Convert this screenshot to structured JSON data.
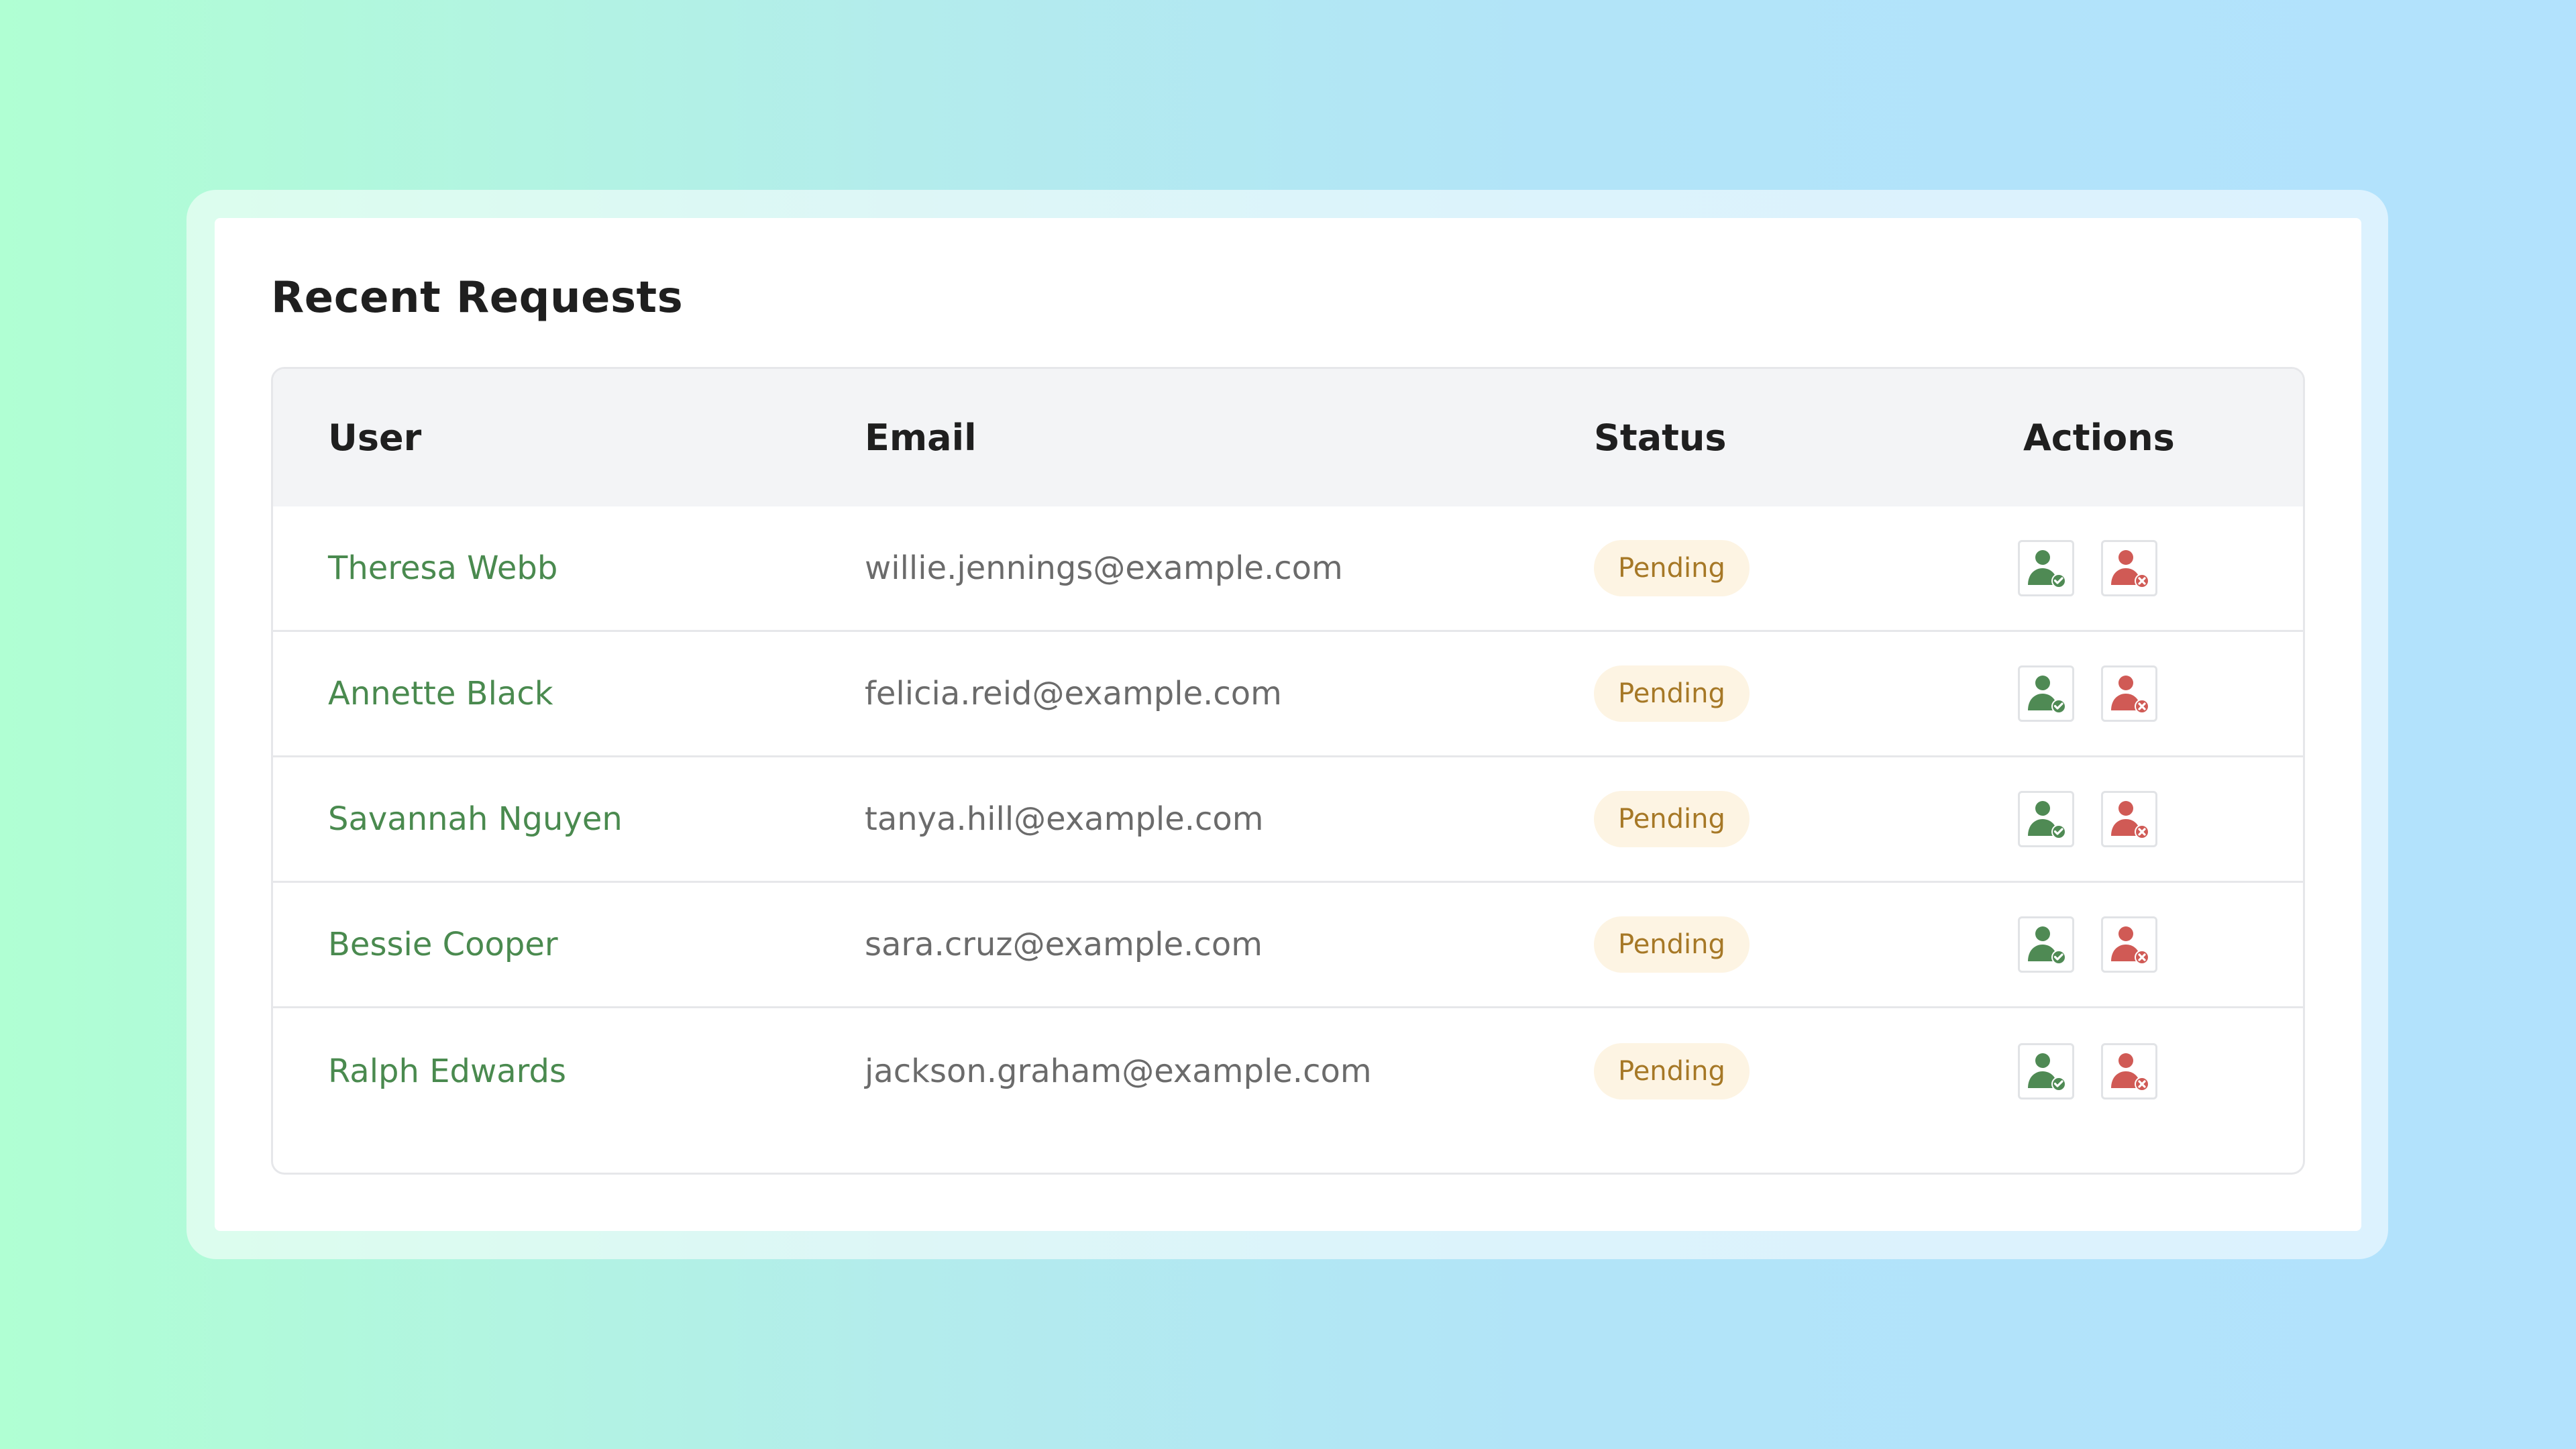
{
  "title": "Recent Requests",
  "columns": {
    "user": "User",
    "email": "Email",
    "status": "Status",
    "actions": "Actions"
  },
  "rows": [
    {
      "user": "Theresa Webb",
      "email": "willie.jennings@example.com",
      "status": "Pending"
    },
    {
      "user": "Annette Black",
      "email": "felicia.reid@example.com",
      "status": "Pending"
    },
    {
      "user": "Savannah Nguyen",
      "email": "tanya.hill@example.com",
      "status": "Pending"
    },
    {
      "user": "Bessie Cooper",
      "email": "sara.cruz@example.com",
      "status": "Pending"
    },
    {
      "user": "Ralph Edwards",
      "email": "jackson.graham@example.com",
      "status": "Pending"
    }
  ],
  "icons": {
    "approve": "user-check-icon",
    "reject": "user-remove-icon"
  },
  "colors": {
    "user_name": "#4a8a4f",
    "approve_icon": "#4f8a54",
    "reject_icon": "#d05a55",
    "badge_bg": "#fdf4e3",
    "badge_text": "#a67826"
  }
}
